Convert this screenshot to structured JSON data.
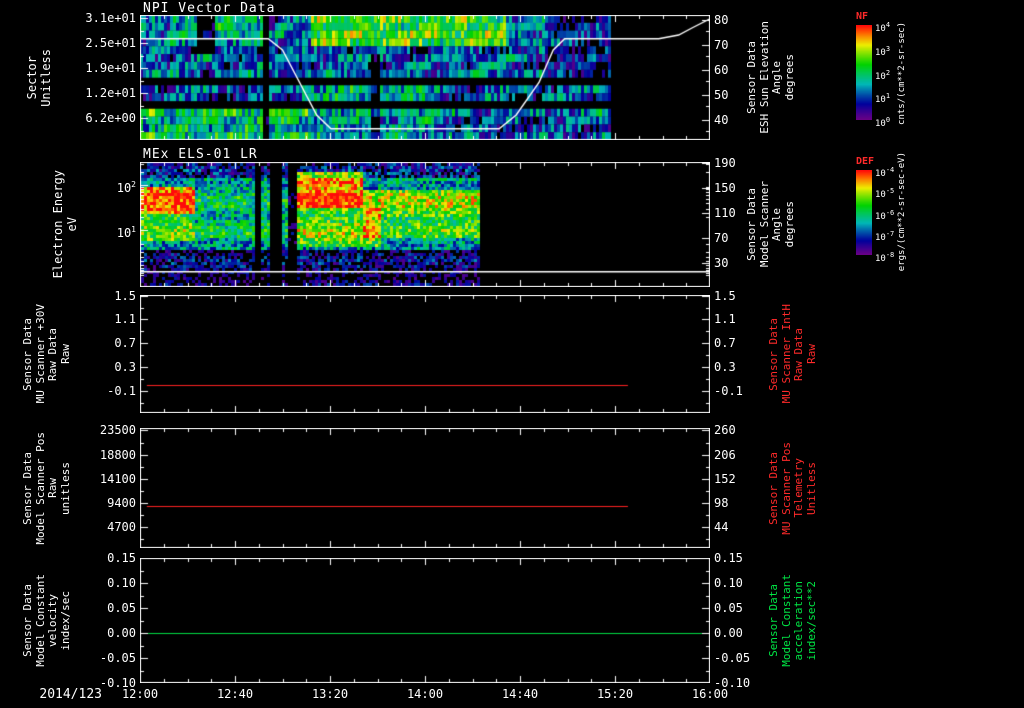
{
  "app": {
    "background": "#000000",
    "axis_color": "#ffffff",
    "red_label_color": "#ff2a2a",
    "green_label_color": "#00e645"
  },
  "xaxis": {
    "date_label": "2014/123",
    "ticks": [
      "12:00",
      "12:40",
      "13:20",
      "14:00",
      "14:40",
      "15:20",
      "16:00"
    ]
  },
  "chart_data": [
    {
      "id": "npi",
      "type": "heatmap",
      "title": "NPI Vector Data",
      "left_label_lines": [
        "Sector",
        "Unitless"
      ],
      "yticks": [
        "3.1e+01",
        "2.5e+01",
        "1.9e+01",
        "1.2e+01",
        "6.2e+00"
      ],
      "ytick_fracs": [
        0.024,
        0.224,
        0.424,
        0.624,
        0.824
      ],
      "yminor_fracs": [
        0.124,
        0.324,
        0.524,
        0.724,
        0.924
      ],
      "right_label_lines": [
        "Sensor Data",
        "ESH Sun Elevation",
        "Angle",
        "degrees"
      ],
      "right_label_color": "#ffffff",
      "rticks": [
        "80",
        "70",
        "60",
        "50",
        "40"
      ],
      "rtick_fracs": [
        0.04,
        0.24,
        0.44,
        0.64,
        0.84
      ],
      "colorbar": {
        "title": "NF",
        "title_color": "#ff2a2a",
        "ticks": [
          "10^4",
          "10^3",
          "10^2",
          "10^1",
          "10^0"
        ],
        "unit": "cnts/(cm**2-sr-sec)"
      },
      "heatmap": {
        "x_end": 0.825,
        "rows": 16,
        "base": 0.28,
        "noise": 0.2,
        "seed": 42,
        "features": [
          {
            "x0": 0.3,
            "x1": 0.64,
            "y0": 0.0,
            "y1": 0.23,
            "dv": 0.3
          },
          {
            "x0": 0.05,
            "x1": 0.22,
            "y0": 0.0,
            "y1": 0.16,
            "dv": 0.12
          },
          {
            "x0": 0.1,
            "x1": 0.13,
            "y0": 0.0,
            "y1": 0.3,
            "dv": -0.45
          },
          {
            "x0": 0.0,
            "x1": 0.825,
            "y0": 0.49,
            "y1": 0.585,
            "dv": -0.9
          },
          {
            "x0": 0.0,
            "x1": 0.825,
            "y0": 0.69,
            "y1": 0.78,
            "dv": -0.9
          },
          {
            "x0": 0.0,
            "x1": 0.3,
            "y0": 0.78,
            "y1": 1.0,
            "dv": 0.2
          },
          {
            "x0": 0.3,
            "x1": 0.52,
            "y0": 0.78,
            "y1": 1.0,
            "dv": 0.1
          },
          {
            "x0": 0.28,
            "x1": 0.5,
            "y0": 0.585,
            "y1": 0.69,
            "dv": 0.14
          },
          {
            "x0": 0.715,
            "x1": 0.825,
            "y0": 0.0,
            "y1": 0.49,
            "dv": -0.14
          },
          {
            "x0": 0.212,
            "x1": 0.226,
            "y0": 0.0,
            "y1": 1.0,
            "dv": -0.55
          },
          {
            "x0": 0.405,
            "x1": 0.418,
            "y0": 0.3,
            "y1": 1.0,
            "dv": -0.35
          }
        ]
      },
      "overlay_line": {
        "color": "#ffffff",
        "value_map": {
          "v0": 80,
          "f0": 0.04,
          "v1": 40,
          "f1": 0.84
        },
        "points": [
          [
            0,
            72.5
          ],
          [
            0.225,
            72.5
          ],
          [
            0.25,
            68
          ],
          [
            0.28,
            55
          ],
          [
            0.31,
            42
          ],
          [
            0.335,
            36.5
          ],
          [
            0.63,
            36.5
          ],
          [
            0.66,
            42
          ],
          [
            0.7,
            55
          ],
          [
            0.725,
            68
          ],
          [
            0.745,
            72.5
          ],
          [
            0.91,
            72.5
          ],
          [
            0.945,
            74
          ],
          [
            0.97,
            77
          ],
          [
            1.0,
            80.5
          ]
        ]
      }
    },
    {
      "id": "els",
      "type": "heatmap",
      "title": "MEx ELS-01 LR",
      "left_label_lines": [
        "Electron Energy",
        "eV"
      ],
      "yticks": [
        "10^2",
        "10^1"
      ],
      "ytick_fracs": [
        0.184,
        0.544
      ],
      "yminor_fracs": [
        0.012,
        0.076,
        0.201,
        0.219,
        0.24,
        0.264,
        0.292,
        0.327,
        0.372,
        0.436,
        0.652,
        0.716,
        0.761,
        0.795,
        0.823,
        0.847,
        0.867,
        0.885,
        0.904
      ],
      "right_label_lines": [
        "Sensor Data",
        "Model Scanner",
        "Angle",
        "degrees"
      ],
      "right_label_color": "#ffffff",
      "rticks": [
        "190",
        "150",
        "110",
        "70",
        "30"
      ],
      "rtick_fracs": [
        0.008,
        0.208,
        0.408,
        0.608,
        0.808
      ],
      "colorbar": {
        "title": "DEF",
        "title_color": "#ff2a2a",
        "ticks": [
          "10^-4",
          "10^-5",
          "10^-6",
          "10^-7",
          "10^-8"
        ],
        "unit": "ergs/(cm**2-sr-sec-eV)"
      },
      "heatmap": {
        "x_end": 0.595,
        "base": 0.12,
        "noise": 0.2,
        "seed": 1337,
        "cell": 3,
        "features": [
          {
            "x0": 0.0,
            "x1": 0.595,
            "y0": 0.12,
            "y1": 0.7,
            "dv": 0.3
          },
          {
            "x0": 0.0,
            "x1": 0.595,
            "y0": 0.7,
            "y1": 1.0,
            "dv": -0.04
          },
          {
            "x0": 0.0,
            "x1": 0.095,
            "y0": 0.2,
            "y1": 0.4,
            "dv": 0.5
          },
          {
            "x0": 0.0,
            "x1": 0.095,
            "y0": 0.4,
            "y1": 0.62,
            "dv": 0.2
          },
          {
            "x0": 0.1,
            "x1": 0.27,
            "y0": 0.18,
            "y1": 0.6,
            "dv": 0.05
          },
          {
            "x0": 0.2,
            "x1": 0.212,
            "y0": 0.0,
            "y1": 1.0,
            "dv": -0.7
          },
          {
            "x0": 0.228,
            "x1": 0.244,
            "y0": 0.0,
            "y1": 1.0,
            "dv": -0.7
          },
          {
            "x0": 0.258,
            "x1": 0.272,
            "y0": 0.0,
            "y1": 1.0,
            "dv": -0.5
          },
          {
            "x0": 0.275,
            "x1": 0.39,
            "y0": 0.06,
            "y1": 0.36,
            "dv": 0.52
          },
          {
            "x0": 0.275,
            "x1": 0.42,
            "y0": 0.36,
            "y1": 0.66,
            "dv": 0.25
          },
          {
            "x0": 0.39,
            "x1": 0.595,
            "y0": 0.22,
            "y1": 0.42,
            "dv": 0.28
          },
          {
            "x0": 0.39,
            "x1": 0.595,
            "y0": 0.42,
            "y1": 0.6,
            "dv": 0.16
          }
        ]
      },
      "overlay_line": {
        "color": "#ffffff",
        "value_map": {
          "v0": 190,
          "f0": 0.008,
          "v1": 30,
          "f1": 0.808
        },
        "points": [
          [
            0,
            16
          ],
          [
            1,
            16
          ]
        ]
      }
    },
    {
      "id": "mu30v",
      "type": "line",
      "title": "",
      "left_label_lines": [
        "Sensor Data",
        "MU Scanner +30V",
        "Raw Data",
        "Raw"
      ],
      "yticks": [
        "1.5",
        "1.1",
        "0.7",
        "0.3",
        "-0.1"
      ],
      "ytick_fracs": [
        0.005,
        0.207,
        0.409,
        0.611,
        0.813
      ],
      "yminor_fracs": [
        0.106,
        0.308,
        0.51,
        0.712,
        0.914
      ],
      "right_label_lines": [
        "Sensor Data",
        "MU Scanner IntH",
        "Raw Data",
        "Raw"
      ],
      "right_label_color": "#ff2a2a",
      "rticks": [
        "1.5",
        "1.1",
        "0.7",
        "0.3",
        "-0.1"
      ],
      "rtick_fracs": [
        0.005,
        0.207,
        0.409,
        0.611,
        0.813
      ],
      "series": [
        {
          "name": "MU Scanner +30V Raw Data Raw",
          "color": "#ff2222",
          "value": 0.0,
          "value_frac": 0.762,
          "x0": 0.012,
          "x1": 0.856
        }
      ]
    },
    {
      "id": "scanpos",
      "type": "line",
      "title": "",
      "left_label_lines": [
        "Sensor Data",
        "Model Scanner Pos",
        "Raw",
        "unitless"
      ],
      "yticks": [
        "23500",
        "18800",
        "14100",
        "9400",
        "4700"
      ],
      "ytick_fracs": [
        0.02,
        0.222,
        0.424,
        0.626,
        0.828
      ],
      "yminor_fracs": [
        0.121,
        0.323,
        0.525,
        0.727,
        0.929
      ],
      "right_label_lines": [
        "Sensor Data",
        "MU Scanner Pos",
        "Telemetry",
        "Unitless"
      ],
      "right_label_color": "#ff2a2a",
      "rticks": [
        "260",
        "206",
        "152",
        "98",
        "44"
      ],
      "rtick_fracs": [
        0.02,
        0.222,
        0.424,
        0.626,
        0.828
      ],
      "series": [
        {
          "name": "Model Scanner Pos Raw",
          "color": "#ff2222",
          "value": 8900,
          "value_frac": 0.648,
          "x0": 0.012,
          "x1": 0.856
        }
      ]
    },
    {
      "id": "modelconst",
      "type": "line",
      "title": "",
      "left_label_lines": [
        "Sensor Data",
        "Model Constant",
        "velocity",
        "index/sec"
      ],
      "yticks": [
        "0.15",
        "0.10",
        "0.05",
        "0.00",
        "-0.05",
        "-0.10"
      ],
      "ytick_fracs": [
        0.0,
        0.2,
        0.4,
        0.6,
        0.8,
        1.0
      ],
      "yminor_fracs": [
        0.1,
        0.3,
        0.5,
        0.7,
        0.9
      ],
      "right_label_lines": [
        "Sensor Data",
        "Model Constant",
        "acceleration",
        "index/sec**2"
      ],
      "right_label_color": "#00e645",
      "rticks": [
        "0.15",
        "0.10",
        "0.05",
        "0.00",
        "-0.05",
        "-0.10"
      ],
      "rtick_fracs": [
        0.0,
        0.2,
        0.4,
        0.6,
        0.8,
        1.0
      ],
      "series": [
        {
          "name": "Model Constant velocity",
          "color": "#00dd44",
          "value": 0.0,
          "value_frac": 0.6,
          "x0": 0.012,
          "x1": 0.99
        }
      ]
    }
  ]
}
